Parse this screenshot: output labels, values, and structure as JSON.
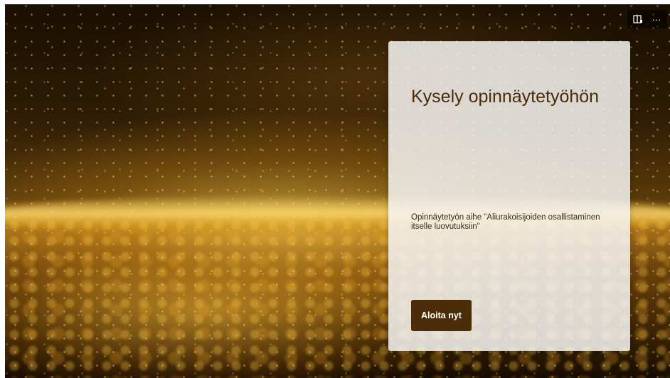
{
  "controls": {
    "immersive_icon": "immersive-reader-icon",
    "more_icon": "more-options-icon",
    "more_glyph": "···"
  },
  "form": {
    "title": "Kysely opinnäytetyöhön",
    "description": "Opinnäytetyön aihe \"Aliurakoisijoiden osallistaminen itselle luovutuksiin\"",
    "start_button": "Aloita nyt"
  },
  "colors": {
    "accent": "#4c2d0a",
    "title_text": "#4a2c0a",
    "card_background": "#f6f4f2"
  }
}
